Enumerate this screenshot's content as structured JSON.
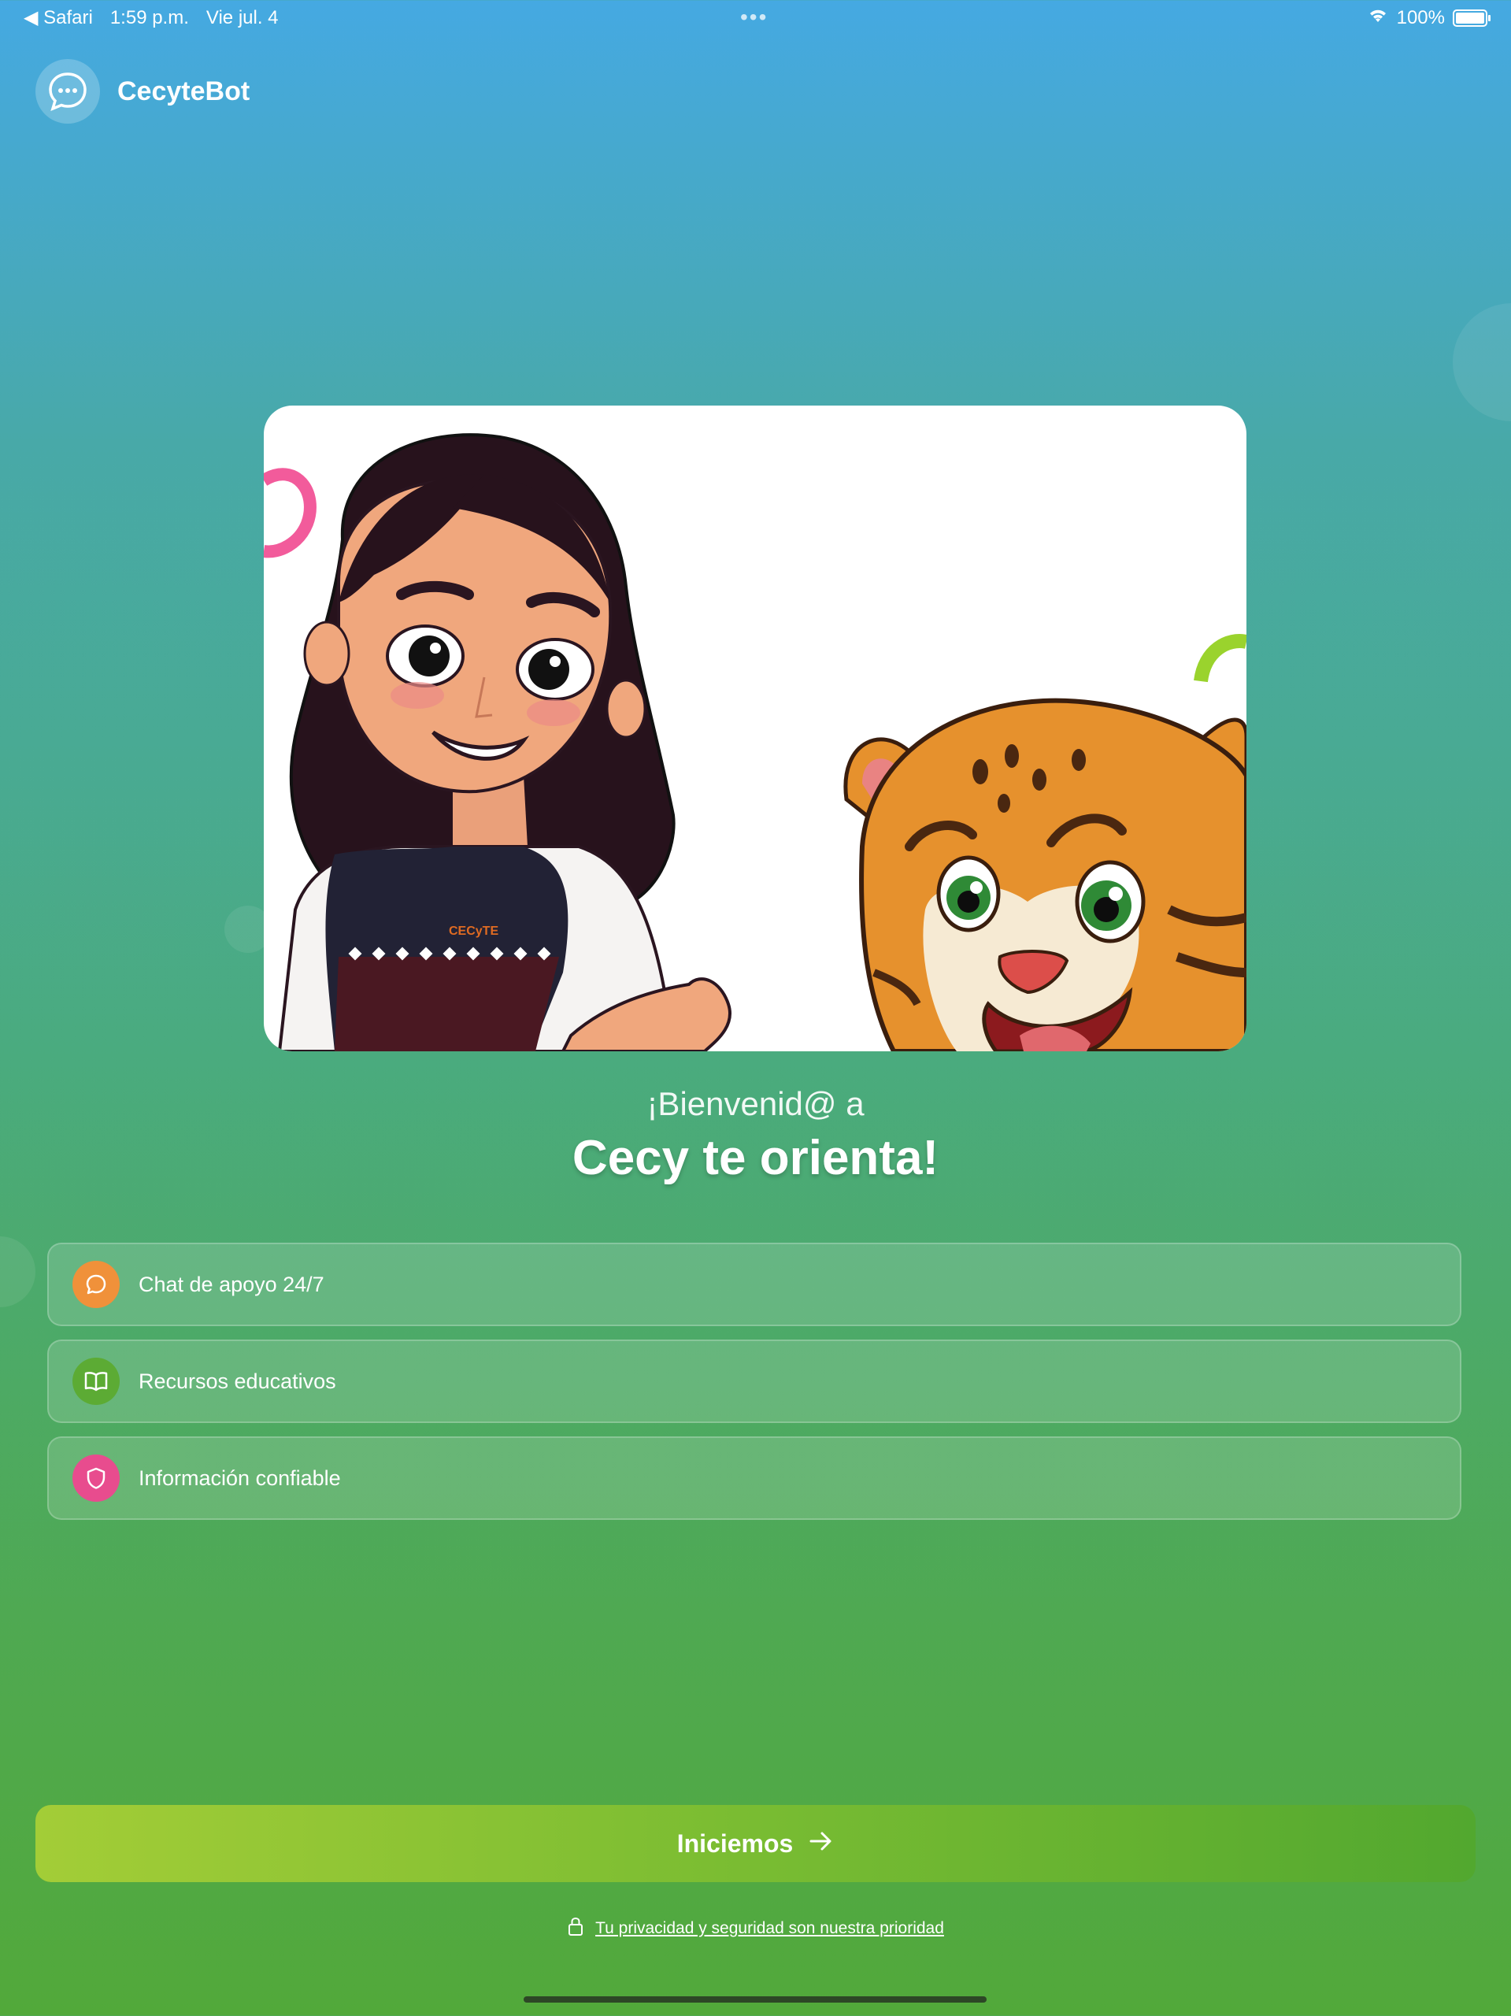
{
  "status_bar": {
    "back_app": "◀ Safari",
    "time": "1:59 p.m.",
    "date": "Vie jul. 4",
    "center_dots": "•••",
    "battery": "100%"
  },
  "header": {
    "app_name": "CecyteBot",
    "logo_icon": "chat-bubble-icon"
  },
  "hero": {
    "image": "illustration-girl-and-jaguar",
    "shirt_logo_text": "CECyTE"
  },
  "welcome": {
    "line1": "¡Bienvenid@ a",
    "line2": "Cecy te orienta!"
  },
  "features": [
    {
      "label": "Chat de apoyo 24/7",
      "icon": "chat-icon",
      "color": "#f0913a"
    },
    {
      "label": "Recursos educativos",
      "icon": "book-icon",
      "color": "#5cab34"
    },
    {
      "label": "Información confiable",
      "icon": "shield-icon",
      "color": "#e84c8e"
    }
  ],
  "cta": {
    "label": "Iniciemos",
    "icon": "arrow-right-icon"
  },
  "privacy": {
    "text": "Tu privacidad y seguridad son nuestra prioridad",
    "icon": "lock-icon"
  },
  "colors": {
    "gradient_top": "#45a9e2",
    "gradient_bottom": "#52a93a",
    "cta_start": "#a3cd37",
    "cta_end": "#52a82f"
  }
}
